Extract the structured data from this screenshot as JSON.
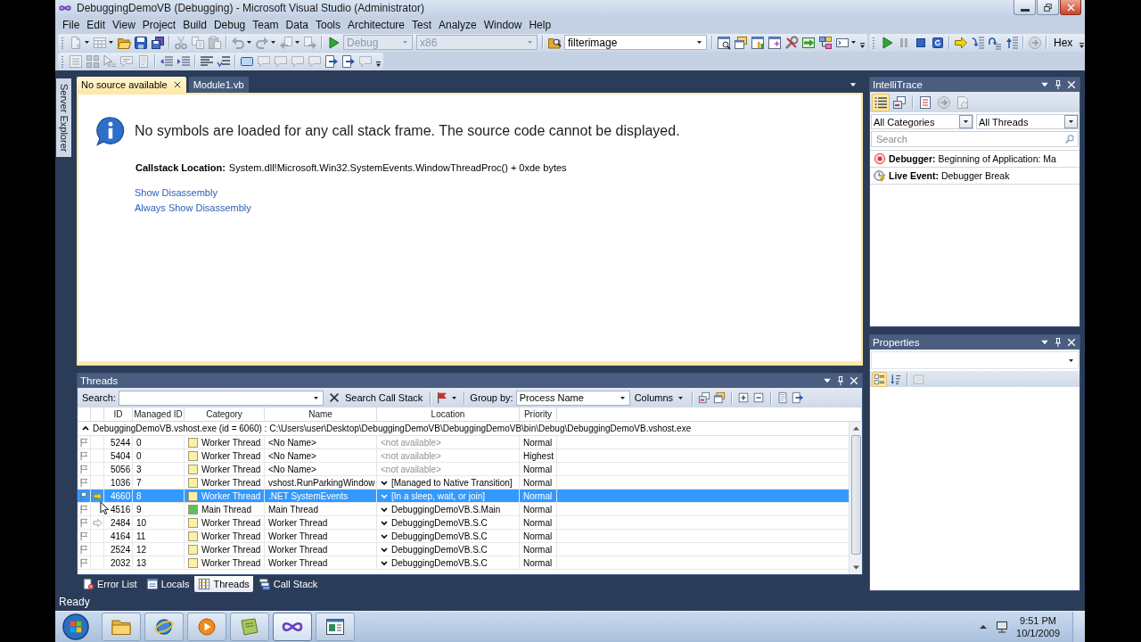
{
  "window": {
    "title": "DebuggingDemoVB (Debugging) - Microsoft Visual Studio (Administrator)"
  },
  "menu": [
    "File",
    "Edit",
    "View",
    "Project",
    "Build",
    "Debug",
    "Team",
    "Data",
    "Tools",
    "Architecture",
    "Test",
    "Analyze",
    "Window",
    "Help"
  ],
  "toolbar_rows": [
    [
      [
        {
          "kind": "document",
          "disabled": true
        },
        {
          "kind": "caret"
        },
        {
          "kind": "table",
          "disabled": true
        },
        {
          "kind": "caret"
        },
        {
          "kind": "folder",
          "disabled": false
        },
        {
          "kind": "save",
          "disabled": false
        },
        {
          "kind": "saveall",
          "disabled": false
        },
        {
          "kind": "separator"
        },
        {
          "kind": "cut",
          "disabled": true
        },
        {
          "kind": "copy",
          "disabled": true
        },
        {
          "kind": "paste",
          "disabled": true
        },
        {
          "kind": "separator"
        },
        {
          "kind": "undo",
          "disabled": true
        },
        {
          "kind": "caret"
        },
        {
          "kind": "redo",
          "disabled": true
        },
        {
          "kind": "caret"
        },
        {
          "kind": "back",
          "disabled": true
        },
        {
          "kind": "caret"
        },
        {
          "kind": "forward",
          "disabled": true
        },
        {
          "kind": "separator"
        },
        {
          "kind": "play",
          "disabled": false
        },
        {
          "kind": "combo",
          "value": "Debug",
          "disabled": true
        },
        {
          "kind": "combo",
          "value": "x86",
          "disabled": true
        },
        {
          "kind": "separator"
        },
        {
          "kind": "findfiles",
          "disabled": false
        },
        {
          "kind": "combo",
          "value": "filterimage",
          "disabled": false
        },
        {
          "kind": "separator"
        },
        {
          "kind": "searchwindow",
          "disabled": false
        },
        {
          "kind": "folders",
          "disabled": false
        },
        {
          "kind": "chartwindow",
          "disabled": false
        },
        {
          "kind": "sparkwindow",
          "disabled": false
        },
        {
          "kind": "tools",
          "disabled": false
        },
        {
          "kind": "import",
          "disabled": false
        },
        {
          "kind": "boxes",
          "disabled": false
        },
        {
          "kind": "console",
          "disabled": false
        },
        {
          "kind": "caret"
        }
      ],
      [
        {
          "kind": "play",
          "disabled": false
        },
        {
          "kind": "pause",
          "disabled": true
        },
        {
          "kind": "stop",
          "disabled": false
        },
        {
          "kind": "restart",
          "disabled": false
        },
        {
          "kind": "separator"
        },
        {
          "kind": "nextstatement",
          "disabled": false
        },
        {
          "kind": "stepinto",
          "disabled": false
        },
        {
          "kind": "stepover",
          "disabled": false
        },
        {
          "kind": "stepout",
          "disabled": false
        },
        {
          "kind": "separator"
        },
        {
          "kind": "circlearrow",
          "disabled": true
        },
        {
          "kind": "separator"
        },
        {
          "kind": "text",
          "label": "Hex",
          "selected": false
        }
      ]
    ],
    [
      [
        {
          "kind": "windowlist",
          "disabled": true
        },
        {
          "kind": "squares",
          "disabled": true
        },
        {
          "kind": "pointer",
          "disabled": true
        },
        {
          "kind": "quickinfo",
          "disabled": true
        },
        {
          "kind": "listpage",
          "disabled": true
        },
        {
          "kind": "separator"
        },
        {
          "kind": "outdent",
          "disabled": false
        },
        {
          "kind": "indent",
          "disabled": false
        },
        {
          "kind": "separator"
        },
        {
          "kind": "lines",
          "disabled": false
        },
        {
          "kind": "undoline",
          "disabled": false
        },
        {
          "kind": "separator"
        },
        {
          "kind": "rectangle",
          "disabled": false
        },
        {
          "kind": "bubble",
          "disabled": true
        },
        {
          "kind": "bubble",
          "disabled": true
        },
        {
          "kind": "bubble",
          "disabled": true
        },
        {
          "kind": "bubble",
          "disabled": true
        },
        {
          "kind": "pagearrow",
          "disabled": false
        },
        {
          "kind": "pagearrow",
          "disabled": false
        },
        {
          "kind": "bubble",
          "disabled": true
        }
      ]
    ]
  ],
  "side_tabs": [
    "Server Explorer"
  ],
  "document_tabs": [
    {
      "label": "No source available",
      "selected": true
    },
    {
      "label": "Module1.vb",
      "selected": false
    }
  ],
  "document": {
    "heading": "No symbols are loaded for any call stack frame. The source code cannot be displayed.",
    "location_label": "Callstack Location:",
    "location": "System.dll!Microsoft.Win32.SystemEvents.WindowThreadProc() + 0xde bytes",
    "links": [
      "Show Disassembly",
      "Always Show Disassembly"
    ]
  },
  "intellitrace": {
    "title": "IntelliTrace",
    "tools": [
      {
        "kind": "list",
        "selected": true,
        "disabled": false
      },
      {
        "kind": "windows",
        "selected": false,
        "disabled": false
      },
      {
        "kind": "separator"
      },
      {
        "kind": "checklist",
        "selected": false,
        "disabled": false
      },
      {
        "kind": "circlearrow",
        "selected": false,
        "disabled": true
      },
      {
        "kind": "pageclock",
        "selected": false,
        "disabled": true
      }
    ],
    "category_filter": "All Categories",
    "thread_filter": "All Threads",
    "search_placeholder": "Search",
    "events": [
      {
        "kind": "debugger",
        "text": "**Debugger:** Beginning of Application: Ma"
      },
      {
        "kind": "live",
        "text": "**Live Event:** Debugger Break"
      }
    ]
  },
  "properties": {
    "title": "Properties",
    "tools": [
      {
        "kind": "categorized",
        "selected": true,
        "disabled": false
      },
      {
        "kind": "alphabetical",
        "selected": false,
        "disabled": false
      },
      {
        "kind": "separator"
      },
      {
        "kind": "pages",
        "selected": false,
        "disabled": true
      }
    ]
  },
  "threads_window": {
    "title": "Threads",
    "search_label": "Search:",
    "search_call_stack": "Search Call Stack",
    "group_by_label": "Group by:",
    "group_by": "Process Name",
    "columns_button": "Columns",
    "columns": [
      "ID",
      "Managed ID",
      "Category",
      "Name",
      "Location",
      "Priority"
    ],
    "group": {
      "label": "DebuggingDemoVB.vshost.exe (id = 6060) : C:\\Users\\user\\Desktop\\DebuggingDemoVB\\DebuggingDemoVB\\bin\\Debug\\DebuggingDemoVB.vshost.exe",
      "expanded": true
    },
    "rows": [
      {
        "kind": "plain",
        "id": "5244",
        "managed_id": "0",
        "category": "Worker Thread",
        "color": "#fdf0a6",
        "name": "<No Name>",
        "location": "<not available>",
        "expandable": false,
        "priority": "Normal",
        "flagged": false,
        "selected": false
      },
      {
        "kind": "plain",
        "id": "5404",
        "managed_id": "0",
        "category": "Worker Thread",
        "color": "#fdf0a6",
        "name": "<No Name>",
        "location": "<not available>",
        "expandable": false,
        "priority": "Highest",
        "flagged": false,
        "selected": false
      },
      {
        "kind": "plain",
        "id": "5056",
        "managed_id": "3",
        "category": "Worker Thread",
        "color": "#fdf0a6",
        "name": "<No Name>",
        "location": "<not available>",
        "expandable": false,
        "priority": "Normal",
        "flagged": false,
        "selected": false
      },
      {
        "kind": "plain",
        "id": "1036",
        "managed_id": "7",
        "category": "Worker Thread",
        "color": "#fdf0a6",
        "name": "vshost.RunParkingWindow",
        "location": "[Managed to Native Transition]",
        "expandable": true,
        "priority": "Normal",
        "flagged": false,
        "selected": false
      },
      {
        "kind": "current",
        "id": "4660",
        "managed_id": "8",
        "category": "Worker Thread",
        "color": "#fdf0a6",
        "name": ".NET SystemEvents",
        "location": "[In a sleep, wait, or join]",
        "expandable": true,
        "priority": "Normal",
        "flagged": false,
        "selected": true
      },
      {
        "kind": "plain",
        "id": "4516",
        "managed_id": "9",
        "category": "Main Thread",
        "color": "#5cbf5c",
        "name": "Main Thread",
        "location": "DebuggingDemoVB.S.Main",
        "expandable": true,
        "priority": "Normal",
        "flagged": false,
        "selected": false
      },
      {
        "kind": "outline",
        "id": "2484",
        "managed_id": "10",
        "category": "Worker Thread",
        "color": "#fdf0a6",
        "name": "Worker Thread",
        "location": "DebuggingDemoVB.S.C",
        "expandable": true,
        "priority": "Normal",
        "flagged": false,
        "selected": false
      },
      {
        "kind": "plain",
        "id": "4164",
        "managed_id": "11",
        "category": "Worker Thread",
        "color": "#fdf0a6",
        "name": "Worker Thread",
        "location": "DebuggingDemoVB.S.C",
        "expandable": true,
        "priority": "Normal",
        "flagged": false,
        "selected": false
      },
      {
        "kind": "plain",
        "id": "2524",
        "managed_id": "12",
        "category": "Worker Thread",
        "color": "#fdf0a6",
        "name": "Worker Thread",
        "location": "DebuggingDemoVB.S.C",
        "expandable": true,
        "priority": "Normal",
        "flagged": false,
        "selected": false
      },
      {
        "kind": "plain",
        "id": "2032",
        "managed_id": "13",
        "category": "Worker Thread",
        "color": "#fdf0a6",
        "name": "Worker Thread",
        "location": "DebuggingDemoVB.S.C",
        "expandable": true,
        "priority": "Normal",
        "flagged": false,
        "selected": false
      }
    ]
  },
  "bottom_tabs": [
    {
      "label": "Error List",
      "kind": "errors",
      "selected": false
    },
    {
      "label": "Locals",
      "kind": "locals",
      "selected": false
    },
    {
      "label": "Threads",
      "kind": "threads",
      "selected": true
    },
    {
      "label": "Call Stack",
      "kind": "callstack",
      "selected": false
    }
  ],
  "status_bar": {
    "text": "Ready"
  },
  "taskbar": {
    "apps": [
      {
        "kind": "folder",
        "active": false
      },
      {
        "kind": "browser",
        "active": false
      },
      {
        "kind": "media",
        "active": false
      },
      {
        "kind": "notebook",
        "active": false
      },
      {
        "kind": "studio",
        "active": true
      },
      {
        "kind": "window",
        "active": false
      }
    ],
    "clock": {
      "time": "9:51 PM",
      "date": "10/1/2009"
    }
  }
}
